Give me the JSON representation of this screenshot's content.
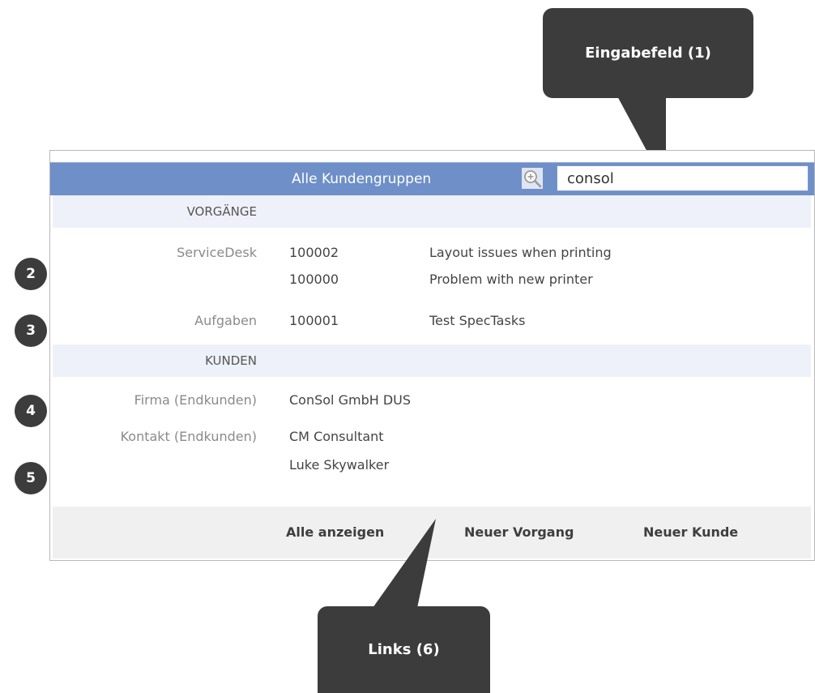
{
  "header": {
    "group_label": "Alle Kundengruppen",
    "zoom_icon": "zoom-in-icon",
    "search_value": "consol"
  },
  "sections": [
    {
      "title": "VORGÄNGE",
      "rows": [
        {
          "category": "ServiceDesk",
          "id": "100002",
          "subject": "Layout issues when printing"
        },
        {
          "category": "",
          "id": "100000",
          "subject": "Problem with new printer"
        },
        {
          "category": "Aufgaben",
          "id": "100001",
          "subject": "Test SpecTasks"
        }
      ]
    },
    {
      "title": "KUNDEN",
      "rows": [
        {
          "category": "Firma (Endkunden)",
          "name": "ConSol GmbH DUS"
        },
        {
          "category": "Kontakt (Endkunden)",
          "name": "CM Consultant"
        },
        {
          "category": "",
          "name": "Luke Skywalker"
        }
      ]
    }
  ],
  "footer": {
    "show_all": "Alle anzeigen",
    "new_ticket": "Neuer Vorgang",
    "new_customer": "Neuer Kunde"
  },
  "annotations": {
    "callout_input": "Eingabefeld (1)",
    "callout_links": "Links (6)",
    "markers": [
      "2",
      "3",
      "4",
      "5"
    ]
  },
  "colors": {
    "header_bg": "#6e8fc8",
    "section_bg": "#eef1f9",
    "footer_bg": "#f0f0f0",
    "callout_bg": "#3c3c3c"
  }
}
